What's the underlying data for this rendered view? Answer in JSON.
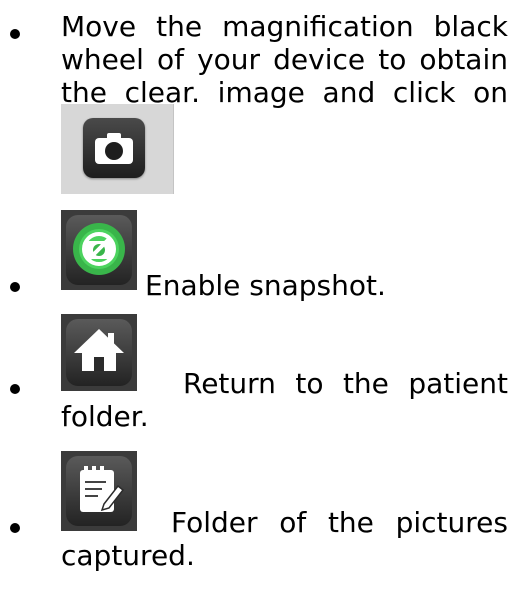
{
  "items": [
    {
      "lines": [
        [
          "Move",
          "the",
          "magnification",
          "black"
        ],
        [
          "wheel",
          "of",
          "your",
          "device",
          "to",
          "obtain"
        ],
        [
          "the",
          "clear.",
          "image",
          "and",
          "click",
          "on"
        ]
      ],
      "icon": "camera-icon"
    },
    {
      "text": "Enable snapshot.",
      "icon": "snapshot-enable-icon"
    },
    {
      "line1": [
        "Return",
        "to",
        "the",
        "patient"
      ],
      "line2": "folder.",
      "icon": "home-icon"
    },
    {
      "line1": [
        "Folder",
        "of",
        "the",
        "pictures"
      ],
      "line2": "captured.",
      "icon": "notepad-edit-icon"
    }
  ]
}
